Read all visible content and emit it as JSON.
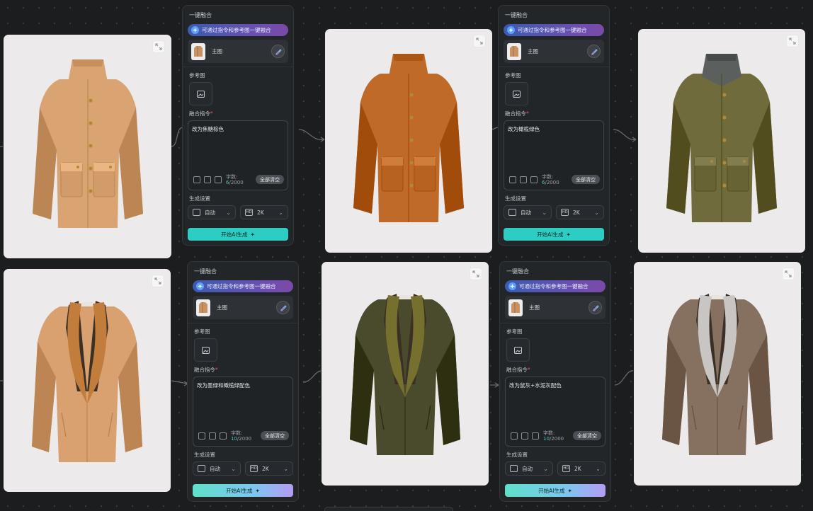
{
  "panels": [
    {
      "title": "一键融合",
      "hint": "可通过指令和参考图一键融合",
      "main_label": "主图",
      "ref_label": "参考图",
      "prompt_label": "融合指令",
      "required": "*",
      "prompt_text": "改为焦糖棕色",
      "count_label": "字数:",
      "count_value": "6",
      "count_max": "/2000",
      "clear_label": "全部清空",
      "settings_label": "生成设置",
      "ratio_value": "自动",
      "res_value": "2K",
      "generate_label": "开始AI生成"
    },
    {
      "title": "一键融合",
      "hint": "可通过指令和参考图一键融合",
      "main_label": "主图",
      "ref_label": "参考图",
      "prompt_label": "融合指令",
      "required": "*",
      "prompt_text": "改为橄榄绿色",
      "count_label": "字数:",
      "count_value": "6",
      "count_max": "/2000",
      "clear_label": "全部清空",
      "settings_label": "生成设置",
      "ratio_value": "自动",
      "res_value": "2K",
      "generate_label": "开始AI生成"
    },
    {
      "title": "一键融合",
      "hint": "可通过指令和参考图一键融合",
      "main_label": "主图",
      "ref_label": "参考图",
      "prompt_label": "融合指令",
      "required": "*",
      "prompt_text": "改为墨绿和橄榄绿配色",
      "count_label": "字数:",
      "count_value": "10",
      "count_max": "/2000",
      "clear_label": "全部清空",
      "settings_label": "生成设置",
      "ratio_value": "自动",
      "res_value": "2K",
      "generate_label": "开始AI生成"
    },
    {
      "title": "一键融合",
      "hint": "可通过指令和参考图一键融合",
      "main_label": "主图",
      "ref_label": "参考图",
      "prompt_label": "融合指令",
      "required": "*",
      "prompt_text": "改为鼠灰+水泥灰配色",
      "count_label": "字数:",
      "count_value": "10",
      "count_max": "/2000",
      "clear_label": "全部清空",
      "settings_label": "生成设置",
      "ratio_value": "自动",
      "res_value": "2K",
      "generate_label": "开始AI生成"
    }
  ],
  "images": [
    {
      "garment": "overcoat",
      "body_color": "#d9a472",
      "collar_color": "#d9a472",
      "icon": "expand-icon"
    },
    {
      "garment": "overcoat",
      "body_color": "#c06a2a",
      "collar_color": "#c06a2a",
      "icon": "expand-icon"
    },
    {
      "garment": "overcoat",
      "body_color": "#6f6b3c",
      "collar_color": "#5b5f5e",
      "icon": "expand-icon"
    },
    {
      "garment": "shawl-jacket",
      "body_color": "#d9a170",
      "collar_color": "#c27d3c",
      "icon": "expand-icon"
    },
    {
      "garment": "shawl-jacket",
      "body_color": "#4a4a2c",
      "collar_color": "#76702f",
      "icon": "expand-icon"
    },
    {
      "garment": "shawl-jacket",
      "body_color": "#86705f",
      "collar_color": "#c8c5c2",
      "icon": "expand-icon"
    }
  ],
  "accent_colors": {
    "generate_teal": "#2ecdc3",
    "hint_gradient": [
      "#3c5bb0",
      "#7a4aa8"
    ],
    "count_highlight": "#4fc6c1",
    "required": "#e9506a"
  }
}
